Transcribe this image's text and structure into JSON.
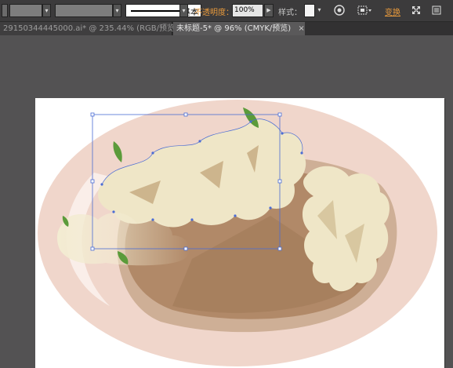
{
  "toolbar": {
    "opacity_label": "不透明度：",
    "opacity_value": "100%",
    "style_label": "样式：",
    "stroke_weight_label": "基本",
    "transform_link": "变换"
  },
  "tabs": [
    {
      "label": "29150344445000.ai* @ 235.44% (RGB/预览)",
      "active": false
    },
    {
      "label": "未标题-5* @ 96% (CMYK/预览)",
      "active": true
    }
  ],
  "icons": {
    "close": "×",
    "dropdown": "▾",
    "play": "▶"
  },
  "colors": {
    "plate": "#f0d6cb",
    "bowl": "#b18968",
    "bowl_shadow": "#ceaf96",
    "rice": "#efe6c7",
    "leaf": "#5b9b3a",
    "selection": "#4a6cd4",
    "accent": "#e89a3c"
  }
}
